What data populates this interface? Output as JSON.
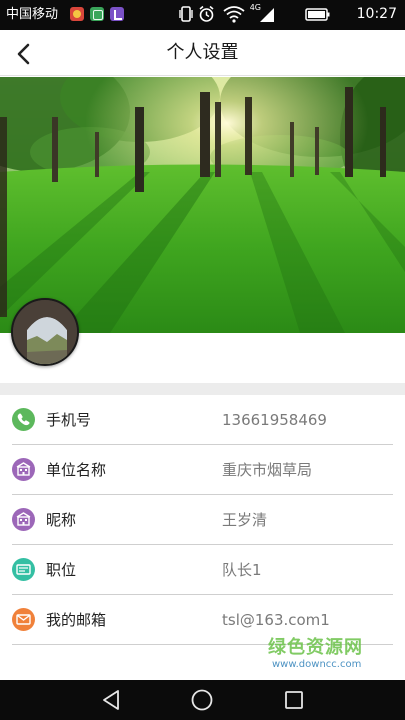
{
  "status_bar": {
    "carrier": "中国移动",
    "network": "4G",
    "time": "10:27",
    "icons": [
      "notification-app-icon",
      "wechat-app-icon",
      "purple-app-icon",
      "vibrate-icon",
      "alarm-icon",
      "wifi-icon",
      "signal-icon",
      "battery-icon"
    ]
  },
  "header": {
    "title": "个人设置",
    "back_icon": "chevron-left-icon"
  },
  "banner": {
    "scene": "forest-park-photo",
    "avatar": "user-avatar-photo"
  },
  "profile": {
    "fields": [
      {
        "label": "手机号",
        "value": "13661958469",
        "icon": "phone-icon",
        "color": "#5cb85c"
      },
      {
        "label": "单位名称",
        "value": "重庆市烟草局",
        "icon": "building-icon",
        "color": "#9c67b8"
      },
      {
        "label": "昵称",
        "value": "王岁清",
        "icon": "building-icon",
        "color": "#9c67b8"
      },
      {
        "label": "职位",
        "value": "队长1",
        "icon": "id-card-icon",
        "color": "#34bfa3"
      },
      {
        "label": "我的邮箱",
        "value": "tsl@163.com1",
        "icon": "mail-icon",
        "color": "#f0813a"
      }
    ]
  },
  "watermark": {
    "title": "绿色资源网",
    "url": "www.downcc.com"
  },
  "nav_bar": {
    "icons": [
      "back-triangle-icon",
      "home-circle-icon",
      "recents-square-icon"
    ]
  }
}
